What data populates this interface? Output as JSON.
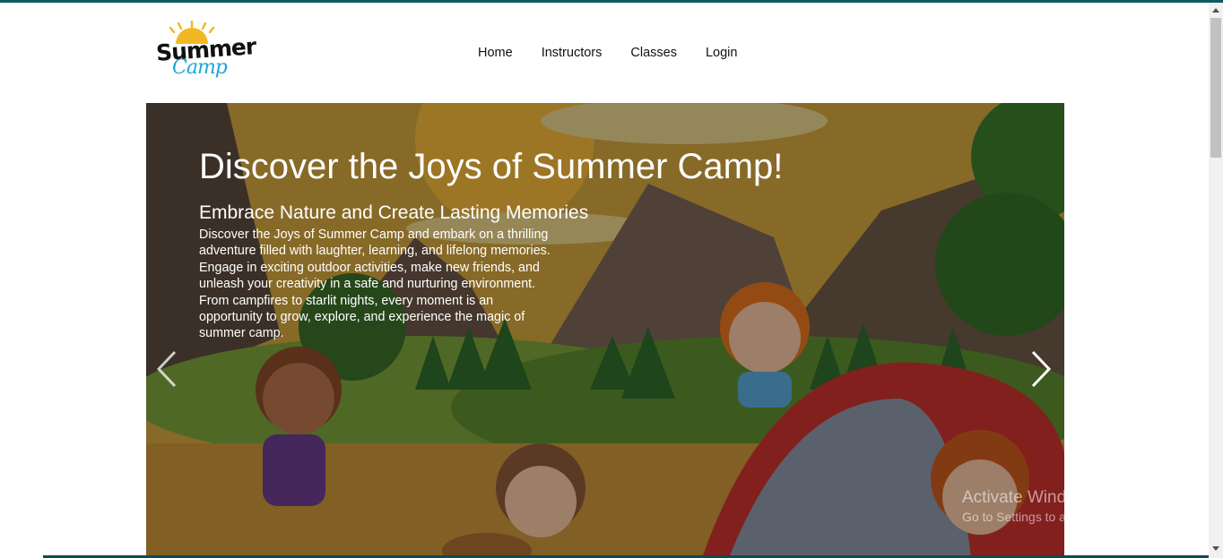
{
  "logo": {
    "line1": "Summer",
    "line2": "Camp",
    "colors": {
      "sun": "#f2b824",
      "word1": "#111111",
      "word2": "#1ba8d9"
    }
  },
  "nav": {
    "items": [
      {
        "label": "Home"
      },
      {
        "label": "Instructors"
      },
      {
        "label": "Classes"
      },
      {
        "label": "Login"
      }
    ]
  },
  "hero": {
    "title": "Discover the Joys of Summer Camp!",
    "subtitle": "Embrace Nature and Create Lasting Memories",
    "text": "Discover the Joys of Summer Camp and embark on a thrilling adventure filled with laughter, learning, and lifelong memories. Engage in exciting outdoor activities, make new friends, and unleash your creativity in a safe and nurturing environment. From campfires to starlit nights, every moment is an opportunity to grow, explore, and experience the magic of summer camp."
  },
  "carousel": {
    "prev_icon": "chevron-left-icon",
    "next_icon": "chevron-right-icon"
  },
  "watermark": {
    "line1": "Activate Windows",
    "line2": "Go to Settings to activate Windows."
  },
  "colors": {
    "top_border": "#0d5c63",
    "hero_text": "#ffffff"
  }
}
